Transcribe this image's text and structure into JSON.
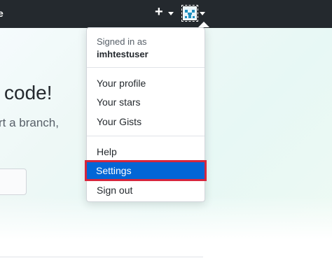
{
  "topbar": {
    "partial_text": "e",
    "plus_symbol": "+"
  },
  "hero": {
    "title_fragment": "code!",
    "subtitle_fragment": "rt a branch,"
  },
  "user_menu": {
    "signed_in_label": "Signed in as",
    "username": "imhtestuser",
    "items": [
      {
        "label": "Your profile"
      },
      {
        "label": "Your stars"
      },
      {
        "label": "Your Gists"
      },
      {
        "label": "Help"
      },
      {
        "label": "Settings",
        "selected": true
      },
      {
        "label": "Sign out"
      }
    ]
  },
  "colors": {
    "header_bg": "#24292e",
    "selected_bg": "#0366d6",
    "highlight_border": "#d7263d"
  },
  "icons": {
    "create_new": "plus-icon",
    "dropdown": "caret-down-icon",
    "avatar": "identicon-avatar"
  }
}
